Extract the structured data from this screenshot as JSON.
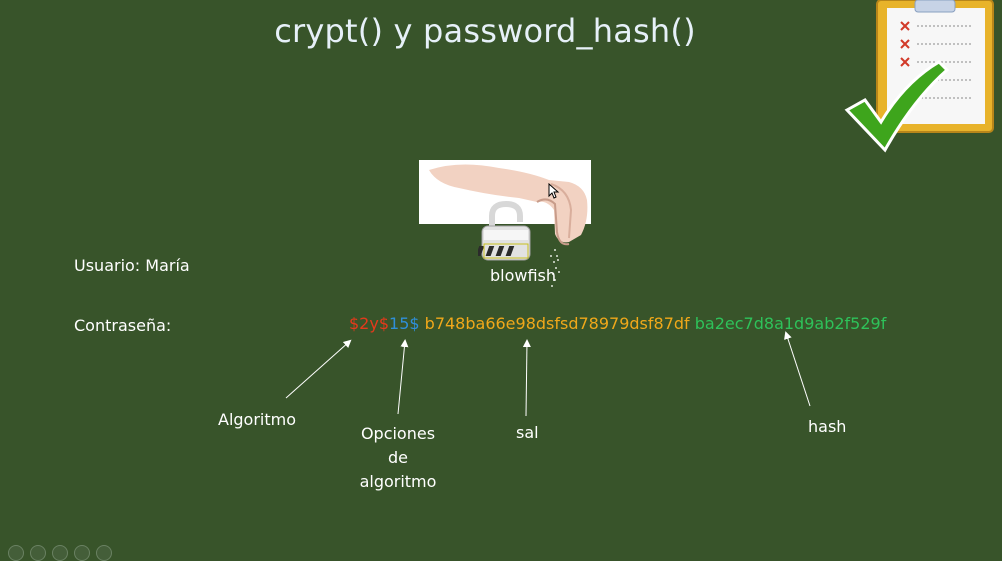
{
  "slide": {
    "title": "crypt() y password_hash()",
    "user_label": "Usuario: María",
    "password_label": "Contraseña:",
    "lock_caption": "blowfish",
    "hash_segments": {
      "algorithm": "$2y$",
      "options": "15$",
      "salt": "b748ba66e98dsfsd78979dsf87df",
      "hash": "ba2ec7d8a1d9ab2f529f"
    },
    "annotations": {
      "algorithm": "Algoritmo",
      "options_line1": "Opciones",
      "options_line2": "de",
      "options_line3": "algoritmo",
      "salt": "sal",
      "hash": "hash"
    }
  },
  "colors": {
    "background": "#38542a",
    "algorithm": "#e43a1b",
    "options": "#2f8fd8",
    "salt": "#f0a81a",
    "hash": "#2ec25a"
  },
  "icons": [
    "hand-salt-icon",
    "padlock-icon",
    "clipboard-check-icon",
    "mouse-cursor-icon"
  ],
  "toolbar": {
    "items": [
      "prev-icon",
      "pen-icon",
      "slides-icon",
      "zoom-icon",
      "more-icon"
    ]
  }
}
